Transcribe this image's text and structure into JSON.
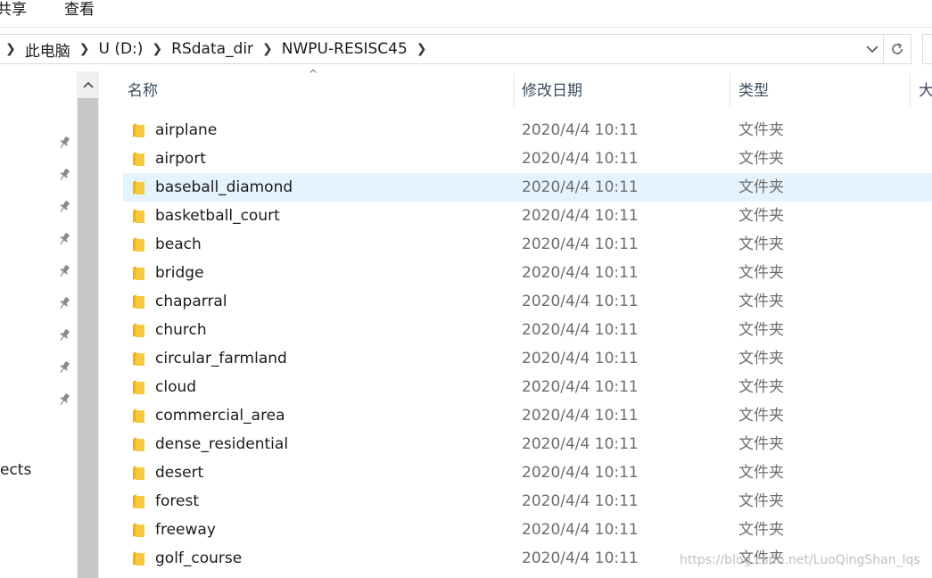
{
  "ribbon": {
    "tabs": [
      "共享",
      "查看"
    ]
  },
  "address": {
    "crumbs": [
      "此电脑",
      "U (D:)",
      "RSdata_dir",
      "NWPU-RESISC45"
    ],
    "dropdown_icon": "chevron-down-icon",
    "refresh_icon": "refresh-icon"
  },
  "nav": {
    "pin_count": 9,
    "partial_label": "ects"
  },
  "columns": {
    "name": "名称",
    "date": "修改日期",
    "type": "类型",
    "size_partial": "大"
  },
  "files": [
    {
      "name": "airplane",
      "date": "2020/4/4 10:11",
      "type": "文件夹"
    },
    {
      "name": "airport",
      "date": "2020/4/4 10:11",
      "type": "文件夹"
    },
    {
      "name": "baseball_diamond",
      "date": "2020/4/4 10:11",
      "type": "文件夹",
      "selected": true
    },
    {
      "name": "basketball_court",
      "date": "2020/4/4 10:11",
      "type": "文件夹"
    },
    {
      "name": "beach",
      "date": "2020/4/4 10:11",
      "type": "文件夹"
    },
    {
      "name": "bridge",
      "date": "2020/4/4 10:11",
      "type": "文件夹"
    },
    {
      "name": "chaparral",
      "date": "2020/4/4 10:11",
      "type": "文件夹"
    },
    {
      "name": "church",
      "date": "2020/4/4 10:11",
      "type": "文件夹"
    },
    {
      "name": "circular_farmland",
      "date": "2020/4/4 10:11",
      "type": "文件夹"
    },
    {
      "name": "cloud",
      "date": "2020/4/4 10:11",
      "type": "文件夹"
    },
    {
      "name": "commercial_area",
      "date": "2020/4/4 10:11",
      "type": "文件夹"
    },
    {
      "name": "dense_residential",
      "date": "2020/4/4 10:11",
      "type": "文件夹"
    },
    {
      "name": "desert",
      "date": "2020/4/4 10:11",
      "type": "文件夹"
    },
    {
      "name": "forest",
      "date": "2020/4/4 10:11",
      "type": "文件夹"
    },
    {
      "name": "freeway",
      "date": "2020/4/4 10:11",
      "type": "文件夹"
    },
    {
      "name": "golf_course",
      "date": "2020/4/4 10:11",
      "type": "文件夹"
    }
  ],
  "watermark": "https://blog.csdn.net/LuoQingShan_lqs",
  "colors": {
    "selection": "#e5f3ff",
    "folder": "#f8c93c",
    "header_text": "#3c4a5e"
  }
}
